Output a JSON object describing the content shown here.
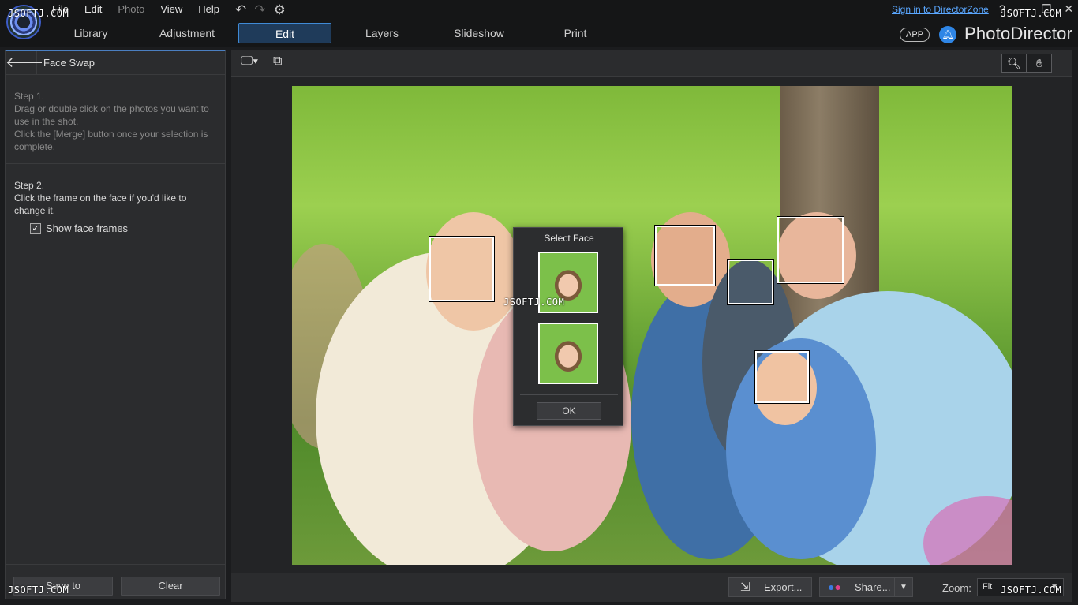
{
  "menu": [
    "File",
    "Edit",
    "Photo",
    "View",
    "Help"
  ],
  "titlebar": {
    "signin": "Sign in to DirectorZone",
    "controls": [
      "?",
      "—",
      "❐",
      "✕"
    ]
  },
  "tabs": [
    "Library",
    "Adjustment",
    "Edit",
    "Layers",
    "Slideshow",
    "Print"
  ],
  "active_tab": "Edit",
  "brand": {
    "app_badge": "APP",
    "name": "PhotoDirector"
  },
  "panel": {
    "title": "Face Swap",
    "step1_title": "Step 1.",
    "step1_text": "Drag or double click on the photos you want to use in the shot.",
    "step1_text2": "Click the [Merge] button once your selection is complete.",
    "step2_title": "Step 2.",
    "step2_text": "Click the frame on the face if you'd like to change it.",
    "show_frames_label": "Show face frames",
    "show_frames_checked": true,
    "save_label": "Save to",
    "clear_label": "Clear"
  },
  "dialog": {
    "title": "Select Face",
    "ok_label": "OK"
  },
  "bottom": {
    "export_label": "Export...",
    "share_label": "Share...",
    "zoom_label": "Zoom:",
    "zoom_value": "Fit"
  },
  "watermark": "JSOFTJ.COM",
  "icons": {
    "back": "arrow-left-icon",
    "monitor": "monitor-icon",
    "compare": "compare-icon",
    "zoom": "magnifier-icon",
    "pan": "hand-icon",
    "undo": "undo-icon",
    "redo": "redo-icon",
    "settings": "gear-icon",
    "notify": "bell-icon"
  },
  "colors": {
    "accent": "#3f8ad6",
    "link": "#5aa7ff",
    "panel": "#2b2c2e",
    "background": "#1b1c1e"
  }
}
